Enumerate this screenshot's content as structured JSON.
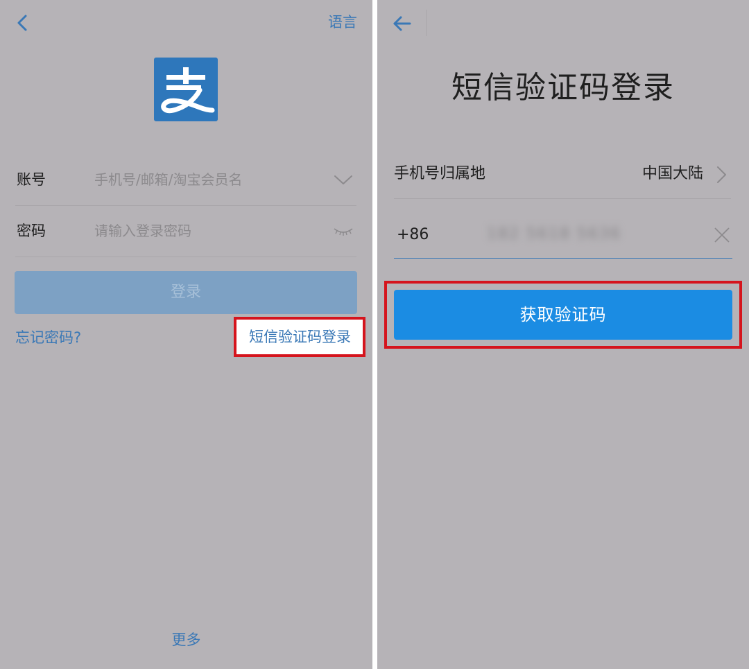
{
  "left": {
    "language_label": "语言",
    "logo_glyph": "支",
    "account": {
      "label": "账号",
      "placeholder": "手机号/邮箱/淘宝会员名"
    },
    "password": {
      "label": "密码",
      "placeholder": "请输入登录密码"
    },
    "login_button": "登录",
    "forgot_password": "忘记密码?",
    "sms_login_link": "短信验证码登录",
    "more_label": "更多",
    "icons": {
      "back": "chevron-left-icon",
      "account_dropdown": "chevron-down-icon",
      "password_visibility": "eye-closed-icon"
    }
  },
  "right": {
    "title": "短信验证码登录",
    "region": {
      "label": "手机号归属地",
      "value": "中国大陆"
    },
    "phone": {
      "prefix": "+86",
      "value": "182 5618 5636"
    },
    "get_code_button": "获取验证码",
    "icons": {
      "back": "arrow-left-icon",
      "region_chevron": "chevron-right-icon",
      "clear": "close-icon"
    }
  },
  "colors": {
    "overlay_background": "#b6b3b7",
    "link_blue": "#3a78b6",
    "primary_button": "#1b8ce3",
    "disabled_button": "#7da1c4",
    "highlight_red": "#d5141d"
  }
}
